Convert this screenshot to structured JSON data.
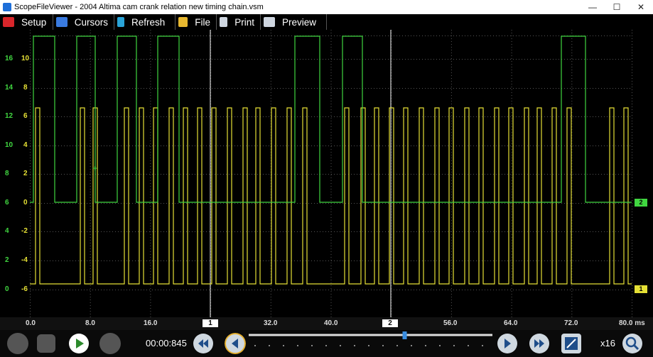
{
  "window": {
    "title": "ScopeFileViewer - 2004 Altima cam crank relation new timing chain.vsm",
    "minimize": "—",
    "maximize": "☐",
    "close": "✕"
  },
  "menu": [
    {
      "label": "Setup",
      "icon": "setup-icon",
      "color": "#d9262b"
    },
    {
      "label": "Cursors",
      "icon": "cursors-icon",
      "color": "#3a7be0"
    },
    {
      "label": "Refresh",
      "icon": "refresh-icon",
      "color": "#2aa4d8"
    },
    {
      "label": "File",
      "icon": "folder-icon",
      "color": "#e8b830"
    },
    {
      "label": "Print",
      "icon": "printer-icon",
      "color": "#cfd6e0"
    },
    {
      "label": "Preview",
      "icon": "print-preview-icon",
      "color": "#cfd6e0"
    }
  ],
  "scale": {
    "green": [
      "16",
      "14",
      "12",
      "10",
      "8",
      "6",
      "4",
      "2",
      "0"
    ],
    "yellow": [
      "10",
      "8",
      "6",
      "4",
      "2",
      "0",
      "-2",
      "-4",
      "-6"
    ],
    "green_color": "#40d640",
    "yellow_color": "#e5e035"
  },
  "channels": {
    "ch1": "1",
    "ch2": "2"
  },
  "time_axis": {
    "labels": [
      "0.0",
      "8.0",
      "16.0",
      "32.0",
      "40.0",
      "56.0",
      "64.0",
      "72.0",
      "80.0 ms"
    ],
    "cursor1": "1",
    "cursor2": "2"
  },
  "controls": {
    "timecode": "00:00:845",
    "zoom": "x16",
    "position_fraction": 0.64
  }
}
